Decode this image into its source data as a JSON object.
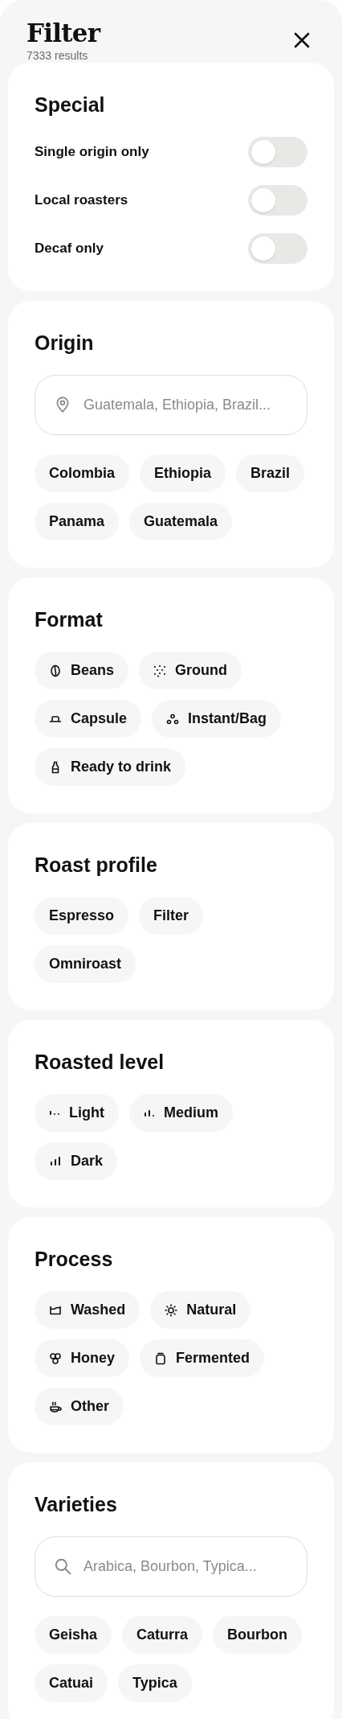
{
  "header": {
    "title": "Filter",
    "results": "7333 results"
  },
  "sections": [
    {
      "kind": "toggles",
      "title": "Special",
      "toggles": [
        {
          "label": "Single origin only",
          "on": false
        },
        {
          "label": "Local roasters",
          "on": false
        },
        {
          "label": "Decaf only",
          "on": false
        }
      ]
    },
    {
      "kind": "chips",
      "title": "Origin",
      "search": {
        "kind": "location",
        "placeholder": "Guatemala, Ethiopia, Brazil..."
      },
      "chips": [
        {
          "label": "Colombia",
          "kind": "plain"
        },
        {
          "label": "Ethiopia",
          "kind": "plain"
        },
        {
          "label": "Brazil",
          "kind": "plain"
        },
        {
          "label": "Panama",
          "kind": "plain"
        },
        {
          "label": "Guatemala",
          "kind": "plain"
        }
      ]
    },
    {
      "kind": "chips",
      "title": "Format",
      "chips": [
        {
          "label": "Beans",
          "kind": "bean"
        },
        {
          "label": "Ground",
          "kind": "ground"
        },
        {
          "label": "Capsule",
          "kind": "capsule"
        },
        {
          "label": "Instant/Bag",
          "kind": "drops"
        },
        {
          "label": "Ready to drink",
          "kind": "bottle"
        }
      ]
    },
    {
      "kind": "chips",
      "title": "Roast profile",
      "chips": [
        {
          "label": "Espresso",
          "kind": "plain"
        },
        {
          "label": "Filter",
          "kind": "plain"
        },
        {
          "label": "Omniroast",
          "kind": "plain"
        }
      ]
    },
    {
      "kind": "chips",
      "title": "Roasted level",
      "chips": [
        {
          "label": "Light",
          "kind": "bars1"
        },
        {
          "label": "Medium",
          "kind": "bars2"
        },
        {
          "label": "Dark",
          "kind": "bars3"
        }
      ]
    },
    {
      "kind": "chips",
      "title": "Process",
      "chips": [
        {
          "label": "Washed",
          "kind": "basin"
        },
        {
          "label": "Natural",
          "kind": "sun"
        },
        {
          "label": "Honey",
          "kind": "honey"
        },
        {
          "label": "Fermented",
          "kind": "jar"
        },
        {
          "label": "Other",
          "kind": "cup"
        }
      ]
    },
    {
      "kind": "chips",
      "title": "Varieties",
      "search": {
        "kind": "search",
        "placeholder": "Arabica, Bourbon, Typica..."
      },
      "chips": [
        {
          "label": "Geisha",
          "kind": "plain"
        },
        {
          "label": "Caturra",
          "kind": "plain"
        },
        {
          "label": "Bourbon",
          "kind": "plain"
        },
        {
          "label": "Catuai",
          "kind": "plain"
        },
        {
          "label": "Typica",
          "kind": "plain"
        }
      ]
    }
  ]
}
